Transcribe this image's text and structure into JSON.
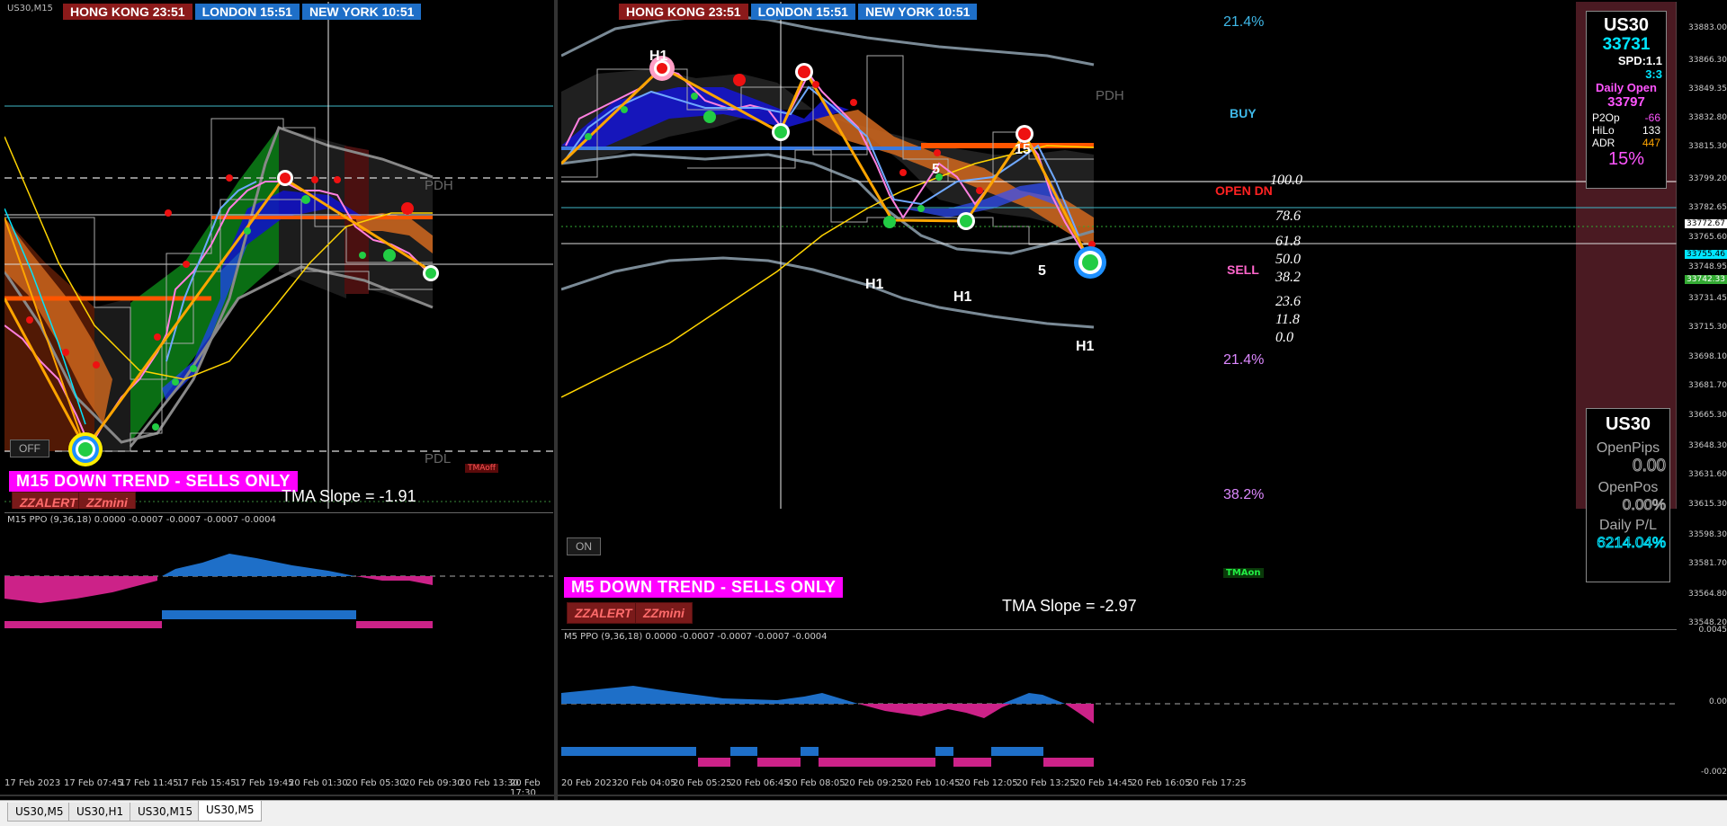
{
  "left_chart": {
    "symbol": "US30,M15",
    "clocks": {
      "hk": "HONG KONG  23:51",
      "ld": "LONDON   15:51",
      "ny": "NEW YORK  10:51"
    },
    "trend_banner": "M15  DOWN TREND - SELLS ONLY",
    "slope": "TMA Slope = -1.91",
    "btn_zzalert": "ZZALERT",
    "btn_zzmini": "ZZmini",
    "btn_off": "OFF",
    "pdh": "PDH",
    "pdl": "PDL",
    "tmaoff": "TMAoff",
    "ppo_label": "M15 PPO (9,36,18) 0.0000 -0.0007 -0.0007 -0.0007 -0.0004",
    "time_labels": [
      "17 Feb 2023",
      "17 Feb 07:45",
      "17 Feb 11:45",
      "17 Feb 15:45",
      "17 Feb 19:45",
      "20 Feb 01:30",
      "20 Feb 05:30",
      "20 Feb 09:30",
      "20 Feb 13:30",
      "20 Feb 17:30"
    ]
  },
  "right_chart": {
    "clocks": {
      "hk": "HONG KONG  23:51",
      "ld": "LONDON   15:51",
      "ny": "NEW YORK  10:51"
    },
    "trend_banner": "M5  DOWN TREND - SELLS ONLY",
    "slope": "TMA Slope = -2.97",
    "btn_zzalert": "ZZALERT",
    "btn_zzmini": "ZZmini",
    "btn_on": "ON",
    "pdh": "PDH",
    "tmaon": "TMAon",
    "ppo_label": "M5 PPO (9,36,18) 0.0000 -0.0007 -0.0007 -0.0007 -0.0004",
    "swing_labels": {
      "h1_top": "H1",
      "h1_low1": "H1",
      "h1_low2": "H1",
      "h1_low3": "H1",
      "five_a": "5",
      "five_b": "5",
      "fifteen": "15"
    },
    "time_labels": [
      "20 Feb 2023",
      "20 Feb 04:05",
      "20 Feb 05:25",
      "20 Feb 06:45",
      "20 Feb 08:05",
      "20 Feb 09:25",
      "20 Feb 10:45",
      "20 Feb 12:05",
      "20 Feb 13:25",
      "20 Feb 14:45",
      "20 Feb 16:05",
      "20 Feb 17:25"
    ],
    "price_axis": [
      "33883.00",
      "33866.30",
      "33849.35",
      "33832.80",
      "33815.30",
      "33799.20",
      "33782.65",
      "33772.67",
      "33765.60",
      "33755.46",
      "33748.95",
      "33742.33",
      "33731.45",
      "33715.30",
      "33698.10",
      "33681.70",
      "33665.30",
      "33648.30",
      "33631.60",
      "33615.30",
      "33598.30",
      "33581.70",
      "33564.80",
      "33548.20"
    ],
    "ppo_axis": [
      "0.0045",
      "0.00",
      "-0.002"
    ],
    "fib": {
      "pct_top": "21.4%",
      "buy": "BUY",
      "open_dn": "OPEN  DN",
      "sell": "SELL",
      "pct_mid": "21.4%",
      "pct_low": "38.2%",
      "levels": [
        "100.0",
        "78.6",
        "61.8",
        "50.0",
        "38.2",
        "23.6",
        "11.8",
        "0.0"
      ]
    }
  },
  "info_top": {
    "symbol": "US30",
    "price": "33731",
    "spd": "SPD:1.1",
    "ratio": "3:3",
    "daily_open_label": "Daily Open",
    "daily_open": "33797",
    "p2op_label": "P2Op",
    "p2op": "-66",
    "hilo_label": "HiLo",
    "hilo": "133",
    "adr_label": "ADR",
    "adr": "447",
    "pct": "15%"
  },
  "info_bottom": {
    "symbol": "US30",
    "open_pips_label": "OpenPips",
    "open_pips": "0.00",
    "open_pos_label": "OpenPos",
    "open_pos": "0.00%",
    "daily_pl_label": "Daily P/L",
    "daily_pl": "6214.04%"
  },
  "tabs": [
    "US30,M5",
    "US30,H1",
    "US30,M15",
    "US30,M5"
  ],
  "colors": {
    "magenta": "#ff00ff",
    "orange": "#ffa500",
    "green_dot": "#22cc44",
    "red_dot": "#ee1111",
    "cyan": "#00e5ff"
  }
}
